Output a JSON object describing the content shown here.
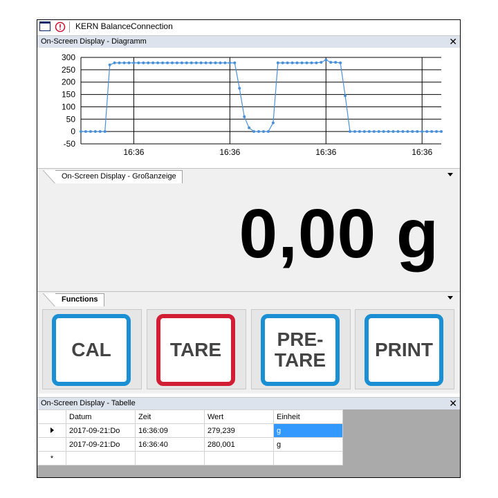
{
  "app": {
    "title": "KERN BalanceConnection"
  },
  "diagram_panel": {
    "title": "On-Screen Display - Diagramm",
    "close": "✕"
  },
  "chart_data": {
    "type": "line",
    "title": "",
    "xlabel": "",
    "ylabel": "",
    "ylim": [
      -50,
      300
    ],
    "yticks": [
      300,
      250,
      200,
      150,
      100,
      50,
      0,
      -50
    ],
    "xtick_labels": [
      "16:36",
      "16:36",
      "16:36",
      "16:36"
    ],
    "grid": true,
    "color": "#4a90d9",
    "series": [
      {
        "values": [
          0,
          0,
          0,
          0,
          0,
          0,
          270,
          278,
          278,
          278,
          278,
          278,
          278,
          278,
          278,
          278,
          278,
          278,
          278,
          278,
          278,
          278,
          278,
          278,
          278,
          278,
          278,
          278,
          278,
          278,
          278,
          278,
          278,
          175,
          60,
          15,
          0,
          0,
          0,
          0,
          35,
          278,
          278,
          278,
          278,
          278,
          278,
          278,
          278,
          278,
          280,
          290,
          280,
          280,
          278,
          145,
          0,
          0,
          0,
          0,
          0,
          0,
          0,
          0,
          0,
          0,
          0,
          0,
          0,
          0,
          0,
          0,
          0,
          0,
          0,
          0
        ]
      }
    ]
  },
  "big_panel": {
    "tab": "On-Screen Display - Großanzeige",
    "value": "0,00 g"
  },
  "functions_panel": {
    "tab": "Functions",
    "buttons": [
      {
        "label": "CAL",
        "color": "#1a8fd4"
      },
      {
        "label": "TARE",
        "color": "#d11e34"
      },
      {
        "label": "PRE-\nTARE",
        "color": "#1a8fd4"
      },
      {
        "label": "PRINT",
        "color": "#1a8fd4"
      }
    ]
  },
  "table_panel": {
    "title": "On-Screen Display - Tabelle",
    "close": "✕",
    "columns": [
      "Datum",
      "Zeit",
      "Wert",
      "Einheit"
    ],
    "rows": [
      [
        "2017-09-21:Do",
        "16:36:09",
        "279,239",
        "g"
      ],
      [
        "2017-09-21:Do",
        "16:36:40",
        "280,001",
        "g"
      ]
    ],
    "new_row_marker": "*"
  }
}
